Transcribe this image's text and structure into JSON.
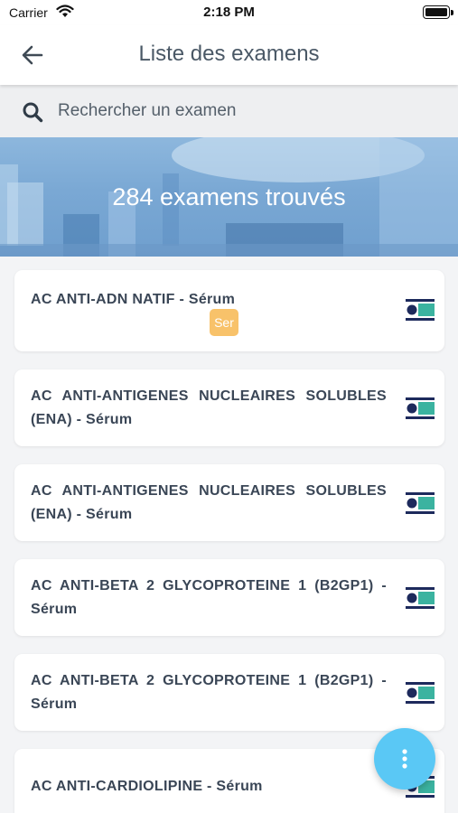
{
  "status_bar": {
    "carrier": "Carrier",
    "time": "2:18 PM"
  },
  "header": {
    "title": "Liste des examens",
    "back_icon": "arrow-left-icon"
  },
  "search": {
    "placeholder": "Rechercher un examen",
    "value": ""
  },
  "banner": {
    "count_text": "284 examens trouvés"
  },
  "exams": [
    {
      "name": "AC ANTI-ADN NATIF - Sérum",
      "badge": "Ser"
    },
    {
      "name": "AC ANTI-ANTIGENES NUCLEAIRES SOLUBLES (ENA) - Sérum"
    },
    {
      "name": "AC ANTI-ANTIGENES NUCLEAIRES SOLUBLES (ENA) - Sérum"
    },
    {
      "name": "AC ANTI-BETA 2 GLYCOPROTEINE 1 (B2GP1) - Sérum"
    },
    {
      "name": "AC ANTI-BETA 2 GLYCOPROTEINE 1 (B2GP1) - Sérum"
    },
    {
      "name": "AC ANTI-CARDIOLIPINE - Sérum"
    }
  ],
  "colors": {
    "badge": "#f8c26a",
    "fab": "#5ac8f5",
    "icon_dark": "#1d2a5c",
    "icon_teal": "#3bb3a0"
  },
  "fab": {
    "icon": "more-vertical-icon"
  }
}
